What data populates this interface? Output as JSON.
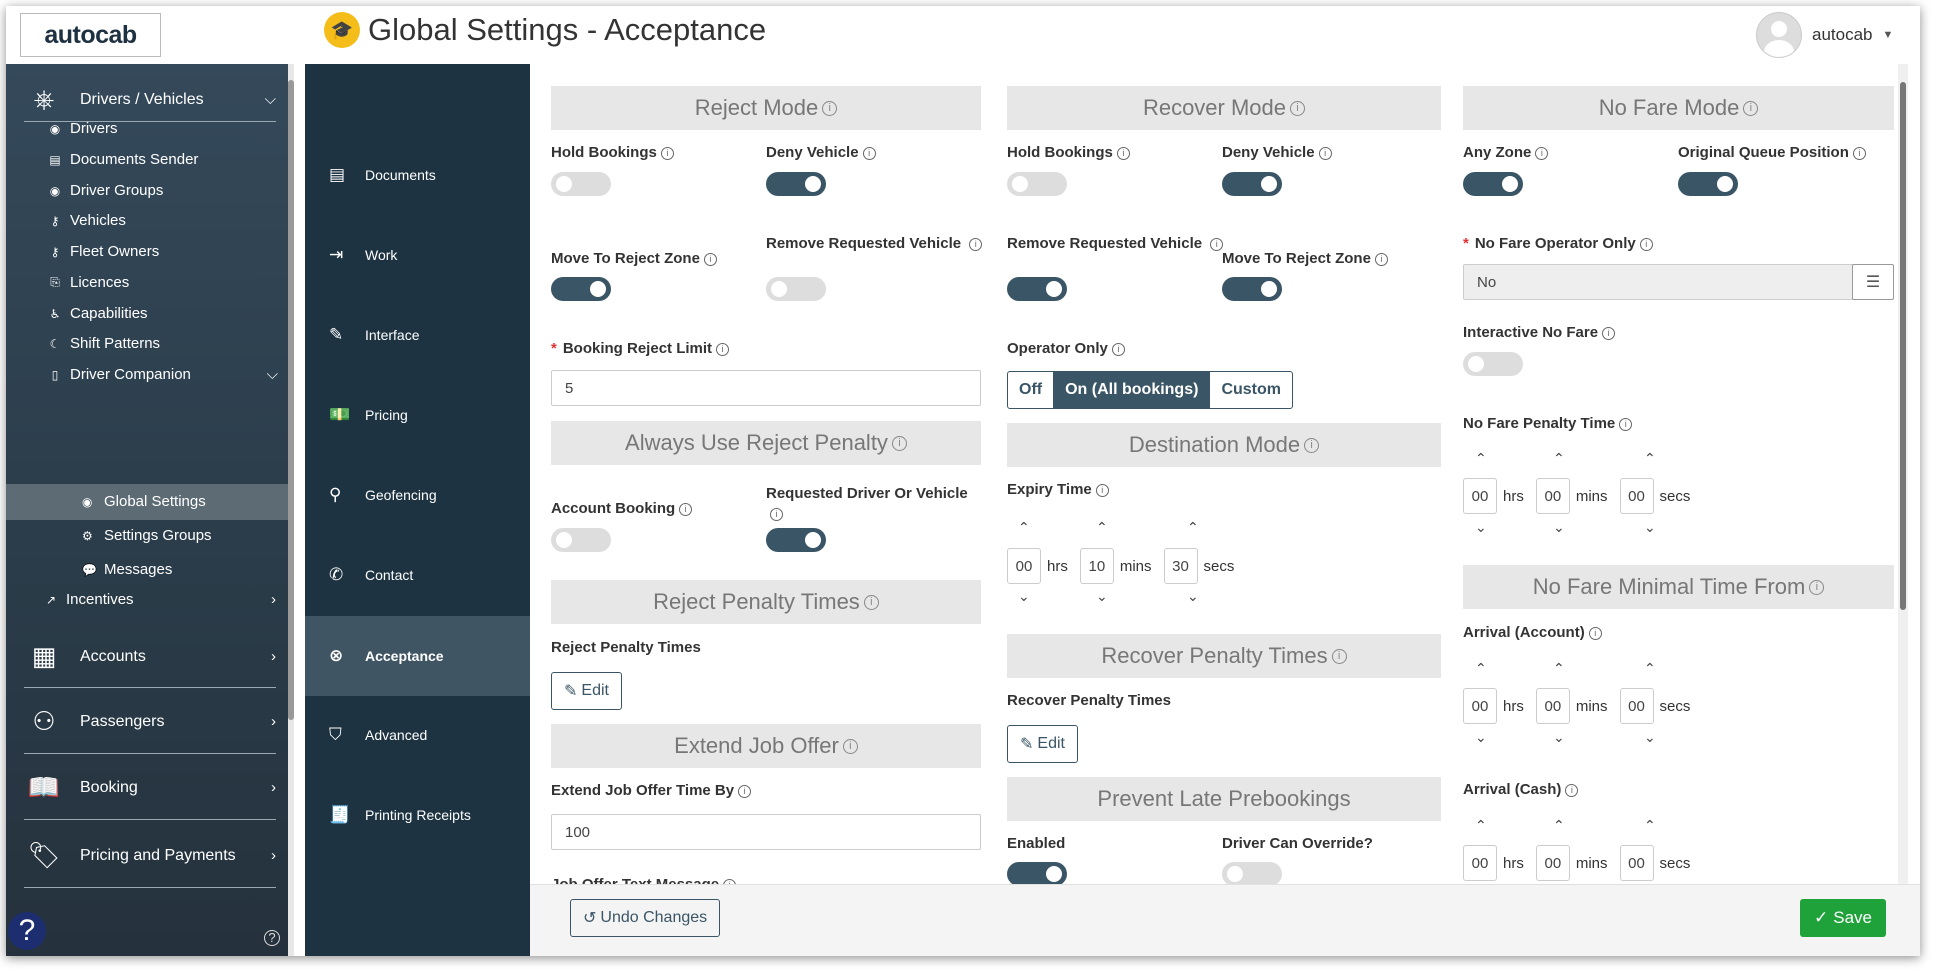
{
  "header": {
    "logo": "autocab",
    "title": "Global Settings - Acceptance",
    "username": "autocab"
  },
  "sidebar": {
    "main": [
      {
        "label": "Drivers / Vehicles",
        "icon": "steering-wheel-icon"
      },
      {
        "label": "Incentives",
        "icon": "chart-icon"
      },
      {
        "label": "Accounts",
        "icon": "building-icon"
      },
      {
        "label": "Passengers",
        "icon": "users-icon"
      },
      {
        "label": "Booking",
        "icon": "book-icon"
      },
      {
        "label": "Pricing and Payments",
        "icon": "tag-icon"
      }
    ],
    "sub": [
      "Drivers",
      "Documents Sender",
      "Driver Groups",
      "Vehicles",
      "Fleet Owners",
      "Licences",
      "Capabilities",
      "Shift Patterns",
      "Driver Companion"
    ],
    "companion": [
      "Global Settings",
      "Settings Groups",
      "Messages"
    ]
  },
  "subnav": [
    "Documents",
    "Work",
    "Interface",
    "Pricing",
    "Geofencing",
    "Contact",
    "Acceptance",
    "Advanced",
    "Printing Receipts"
  ],
  "col1": {
    "reject_mode": "Reject Mode",
    "hold_bookings": "Hold Bookings",
    "deny_vehicle": "Deny Vehicle",
    "move_to_reject_zone": "Move To Reject Zone",
    "remove_requested_vehicle": "Remove Requested Vehicle",
    "booking_reject_limit": "Booking Reject Limit",
    "booking_reject_limit_value": "5",
    "always_use_reject_penalty": "Always Use Reject Penalty",
    "account_booking": "Account Booking",
    "requested_driver_or_vehicle": "Requested Driver Or Vehicle",
    "reject_penalty_times_title": "Reject Penalty Times",
    "reject_penalty_times": "Reject Penalty Times",
    "edit": "Edit",
    "extend_job_offer": "Extend Job Offer",
    "extend_job_offer_time_by": "Extend Job Offer Time By",
    "extend_value": "100",
    "job_offer_text_message": "Job Offer Text Message"
  },
  "col2": {
    "recover_mode": "Recover Mode",
    "hold_bookings": "Hold Bookings",
    "deny_vehicle": "Deny Vehicle",
    "remove_requested_vehicle": "Remove Requested Vehicle",
    "move_to_reject_zone": "Move To Reject Zone",
    "operator_only": "Operator Only",
    "seg_off": "Off",
    "seg_on": "On (All bookings)",
    "seg_custom": "Custom",
    "destination_mode": "Destination Mode",
    "expiry_time": "Expiry Time",
    "expiry_hrs": "00",
    "expiry_mins": "10",
    "expiry_secs": "30",
    "recover_penalty_times_title": "Recover Penalty Times",
    "recover_penalty_times": "Recover Penalty Times",
    "edit": "Edit",
    "prevent_late_prebookings": "Prevent Late Prebookings",
    "enabled": "Enabled",
    "driver_can_override": "Driver Can Override?"
  },
  "col3": {
    "no_fare_mode": "No Fare Mode",
    "any_zone": "Any Zone",
    "original_queue_position": "Original Queue Position",
    "no_fare_operator_only": "No Fare Operator Only",
    "no_fare_operator_value": "No",
    "interactive_no_fare": "Interactive No Fare",
    "no_fare_penalty_time": "No Fare Penalty Time",
    "no_fare_minimal_time_from": "No Fare Minimal Time From",
    "arrival_account": "Arrival (Account)",
    "arrival_cash": "Arrival (Cash)",
    "zero": "00"
  },
  "units": {
    "hrs": "hrs",
    "mins": "mins",
    "secs": "secs"
  },
  "footer": {
    "undo": "Undo Changes",
    "save": "Save"
  }
}
